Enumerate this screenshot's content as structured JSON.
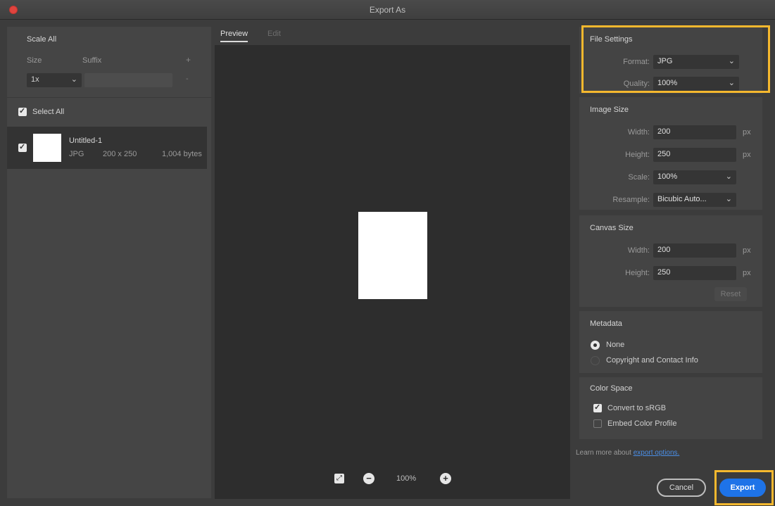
{
  "window": {
    "title": "Export As"
  },
  "left": {
    "scale_title": "Scale All",
    "col_size": "Size",
    "col_suffix": "Suffix",
    "add_icon": "+",
    "remove_icon": "-",
    "scale_value": "1x",
    "suffix_value": "",
    "select_all": "Select All",
    "asset": {
      "name": "Untitled-1",
      "format": "JPG",
      "dimensions": "200 x 250",
      "size": "1,004 bytes"
    }
  },
  "center": {
    "tabs": [
      {
        "label": "Preview"
      },
      {
        "label": "Edit"
      }
    ],
    "zoom": "100%"
  },
  "file_settings": {
    "title": "File Settings",
    "format_label": "Format:",
    "format_value": "JPG",
    "quality_label": "Quality:",
    "quality_value": "100%"
  },
  "image_size": {
    "title": "Image Size",
    "width_label": "Width:",
    "width_value": "200",
    "height_label": "Height:",
    "height_value": "250",
    "unit": "px",
    "scale_label": "Scale:",
    "scale_value": "100%",
    "resample_label": "Resample:",
    "resample_value": "Bicubic Auto..."
  },
  "canvas_size": {
    "title": "Canvas Size",
    "width_label": "Width:",
    "width_value": "200",
    "height_label": "Height:",
    "height_value": "250",
    "unit": "px",
    "reset": "Reset"
  },
  "metadata": {
    "title": "Metadata",
    "options": [
      {
        "label": "None",
        "selected": true
      },
      {
        "label": "Copyright and Contact Info",
        "selected": false
      }
    ]
  },
  "color_space": {
    "title": "Color Space",
    "convert": "Convert to sRGB",
    "convert_checked": true,
    "embed": "Embed Color Profile",
    "embed_checked": false
  },
  "footer": {
    "learn_text": "Learn more about",
    "learn_link": "export options.",
    "cancel": "Cancel",
    "export": "Export"
  },
  "colors": {
    "highlight": "#f5b82e",
    "primary_button": "#1e73e8",
    "close_button": "#e0443e"
  }
}
